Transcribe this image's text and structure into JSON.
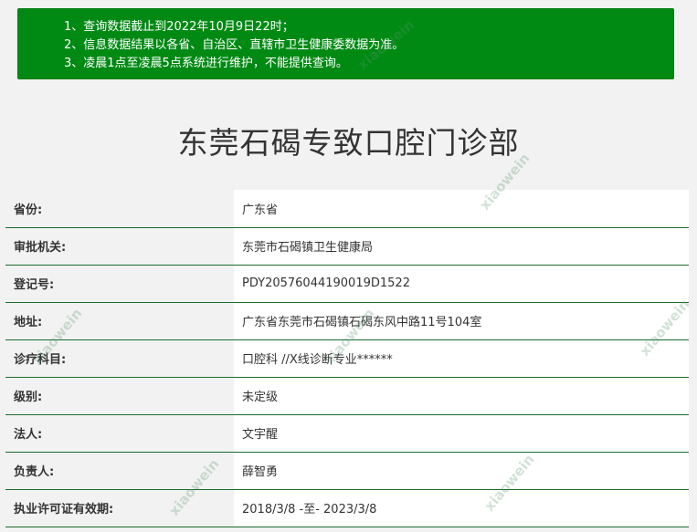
{
  "notice": {
    "lines": [
      "1、查询数据截止到2022年10月9日22时；",
      "2、信息数据结果以各省、自治区、直辖市卫生健康委数据为准。",
      "3、凌晨1点至凌晨5点系统进行维护，不能提供查询。"
    ]
  },
  "page_title": "东莞石碣专致口腔门诊部",
  "rows": [
    {
      "label": "省份:",
      "value": "广东省"
    },
    {
      "label": "审批机关:",
      "value": "东莞市石碣镇卫生健康局"
    },
    {
      "label": "登记号:",
      "value": "PDY20576044190019D1522"
    },
    {
      "label": "地址:",
      "value": "广东省东莞市石碣镇石碣东风中路11号104室"
    },
    {
      "label": "诊疗科目:",
      "value": "口腔科 //X线诊断专业******"
    },
    {
      "label": "级别:",
      "value": "未定级"
    },
    {
      "label": "法人:",
      "value": "文宇醒"
    },
    {
      "label": "负责人:",
      "value": "薛智勇"
    },
    {
      "label": "执业许可证有效期:",
      "value": "2018/3/8 -至- 2023/3/8"
    }
  ],
  "watermark": {
    "text": "xiaowein"
  }
}
